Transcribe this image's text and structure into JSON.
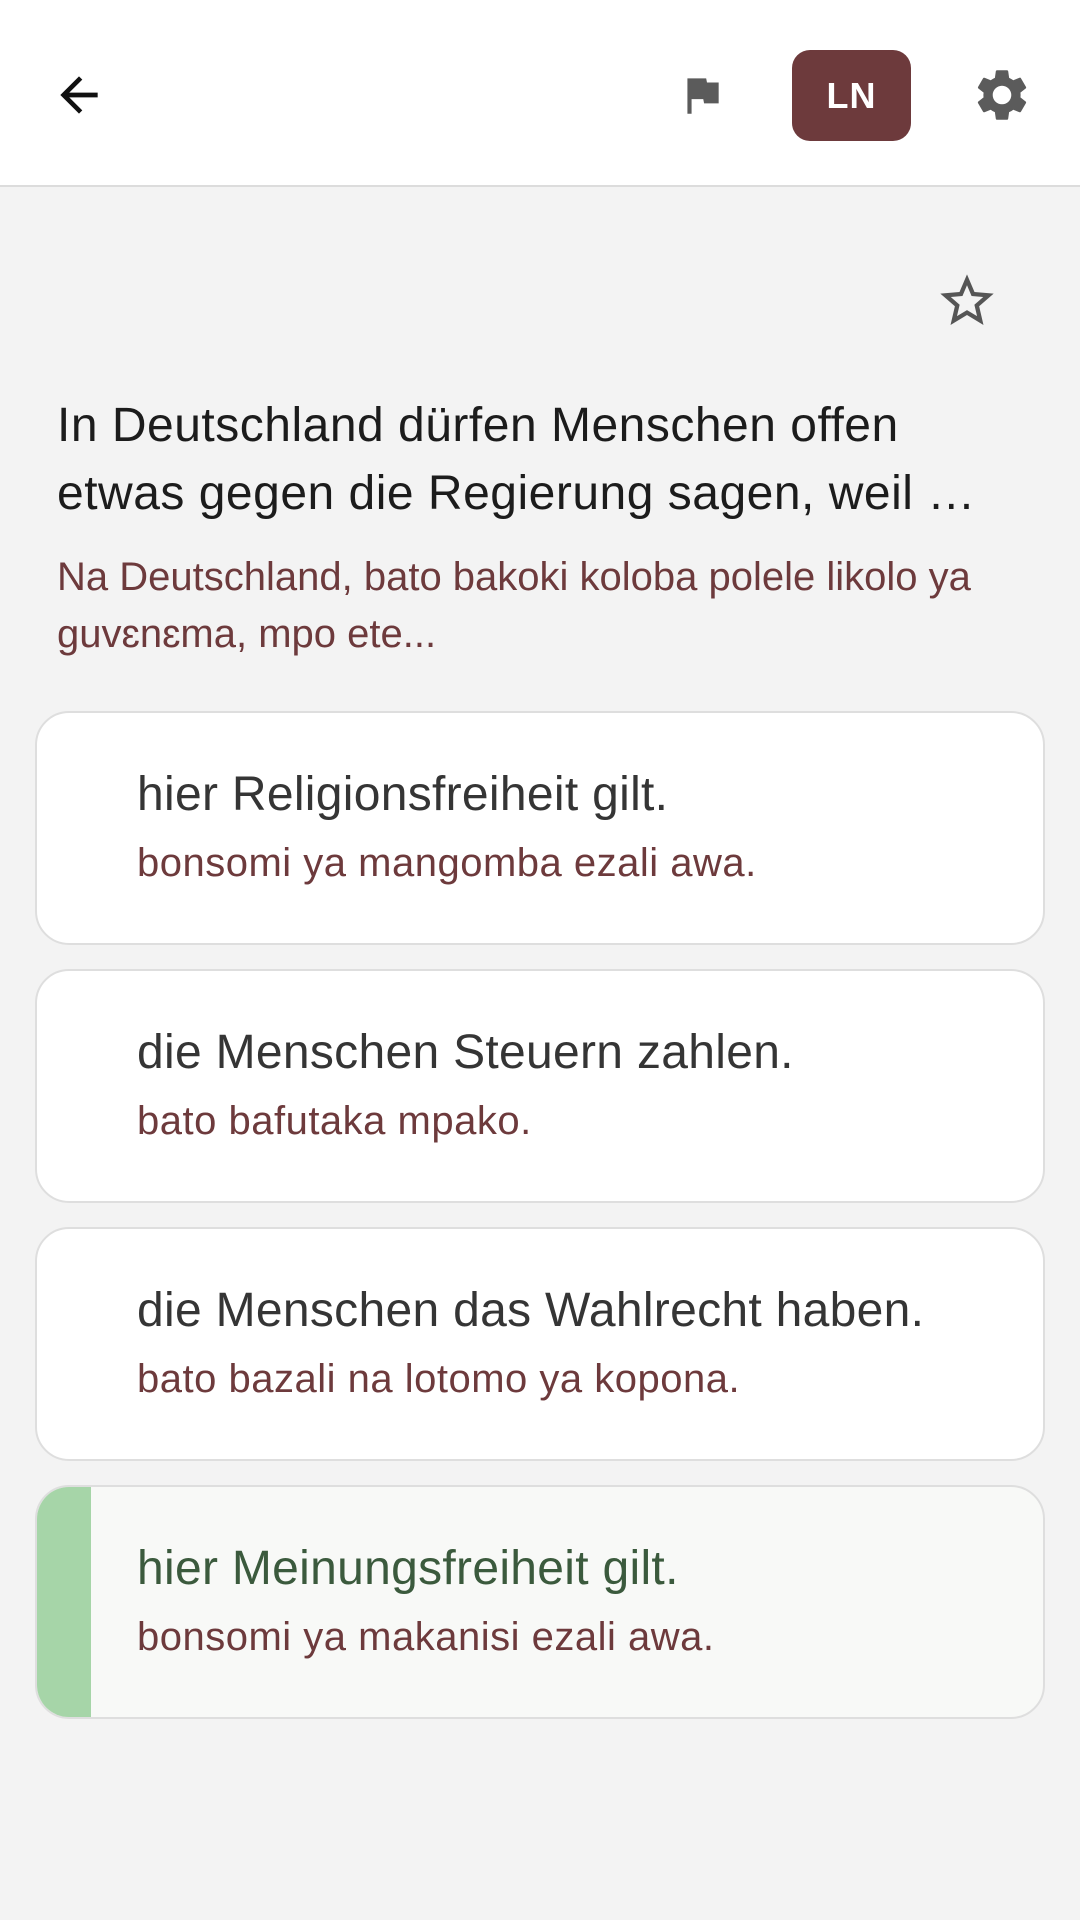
{
  "app_bar": {
    "back_icon": "arrow-left-icon",
    "flag_icon": "flag-icon",
    "language_code": "LN",
    "settings_icon": "gear-icon",
    "accent_color": "#6d3a3c"
  },
  "question": {
    "favorite_icon": "star-outline-icon",
    "text": "In Deutschland dürfen Menschen offen etwas gegen die Regierung sagen, weil …",
    "translation": "Na Deutschland, bato bakoki koloba polele likolo ya guvɛnɛma, mpo ete..."
  },
  "answers": [
    {
      "text": "hier Religionsfreiheit gilt.",
      "translation": "bonsomi ya mangomba ezali awa.",
      "correct": false
    },
    {
      "text": "die Menschen Steuern zahlen.",
      "translation": "bato bafutaka mpako.",
      "correct": false
    },
    {
      "text": "die Menschen das Wahlrecht haben.",
      "translation": "bato bazali na lotomo ya kopona.",
      "correct": false
    },
    {
      "text": "hier Meinungsfreiheit gilt.",
      "translation": "bonsomi ya makanisi ezali awa.",
      "correct": true
    }
  ],
  "colors": {
    "correct_indicator": "#a6d5a8",
    "translation_text": "#6d3a3c"
  }
}
